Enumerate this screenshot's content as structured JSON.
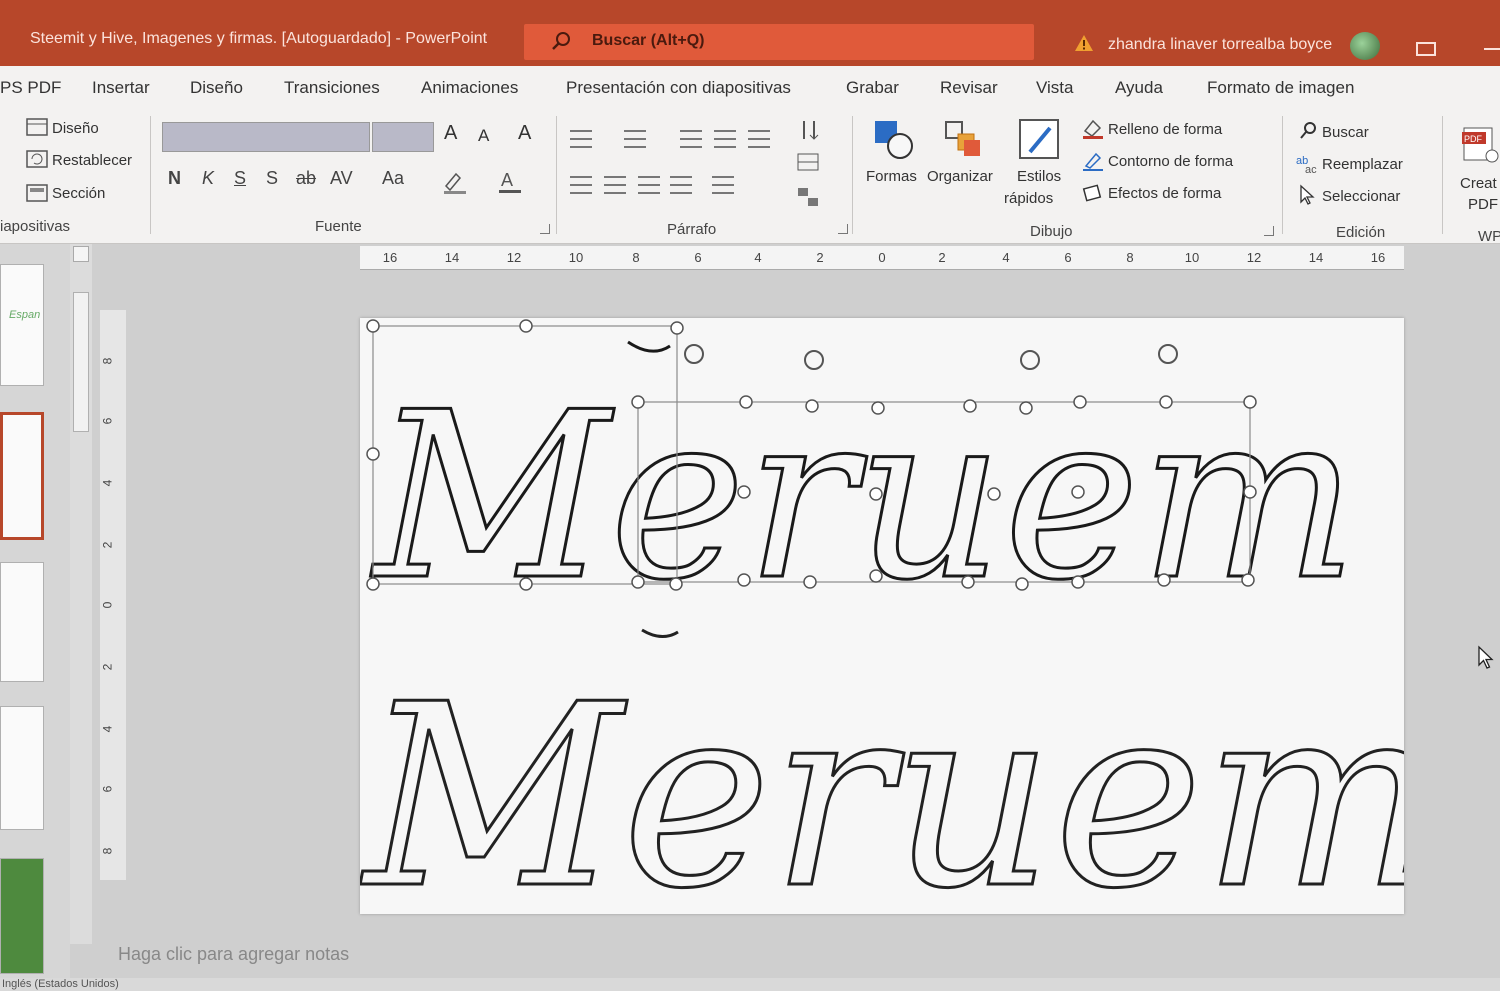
{
  "titlebar": {
    "title": "Steemit y Hive, Imagenes y firmas. [Autoguardado]  -  PowerPoint",
    "search_placeholder": "Buscar (Alt+Q)",
    "user_name": "zhandra linaver torrealba boyce"
  },
  "tabs": [
    "PS PDF",
    "Insertar",
    "Diseño",
    "Transiciones",
    "Animaciones",
    "Presentación con diapositivas",
    "Grabar",
    "Revisar",
    "Vista",
    "Ayuda",
    "Formato de imagen"
  ],
  "ribbon": {
    "slides_group": {
      "label": "iapositivas",
      "items": [
        "Diseño",
        "Restablecer",
        "Sección"
      ]
    },
    "font_group": {
      "label": "Fuente",
      "buttons": [
        "N",
        "K",
        "S",
        "S",
        "ab",
        "AV",
        "Aa"
      ]
    },
    "paragraph_group": {
      "label": "Párrafo"
    },
    "drawing_group": {
      "label": "Dibujo",
      "formas": "Formas",
      "organizar": "Organizar",
      "estilos_line1": "Estilos",
      "estilos_line2": "rápidos",
      "relleno": "Relleno de forma",
      "contorno": "Contorno de forma",
      "efectos": "Efectos de forma"
    },
    "editing_group": {
      "label": "Edición",
      "buscar": "Buscar",
      "reemplazar": "Reemplazar",
      "seleccionar": "Seleccionar"
    },
    "pdf_group": {
      "line1": "Creat",
      "line2": "PDF",
      "label": "WP"
    }
  },
  "thumbnail_text": "Espan",
  "ruler_h": [
    "16",
    "14",
    "12",
    "10",
    "8",
    "6",
    "4",
    "2",
    "0",
    "2",
    "4",
    "6",
    "8",
    "10",
    "12",
    "14",
    "16"
  ],
  "ruler_v": [
    "8",
    "6",
    "4",
    "2",
    "0",
    "2",
    "4",
    "6",
    "8"
  ],
  "slide": {
    "word_top": "Meruem",
    "word_bottom": "Meruem"
  },
  "notes_placeholder": "Haga clic para agregar notas",
  "status_text": "Inglés (Estados Unidos)",
  "colors": {
    "titlebar": "#b7472a",
    "searchbox": "#e05a3a",
    "accent": "#2b579a"
  }
}
